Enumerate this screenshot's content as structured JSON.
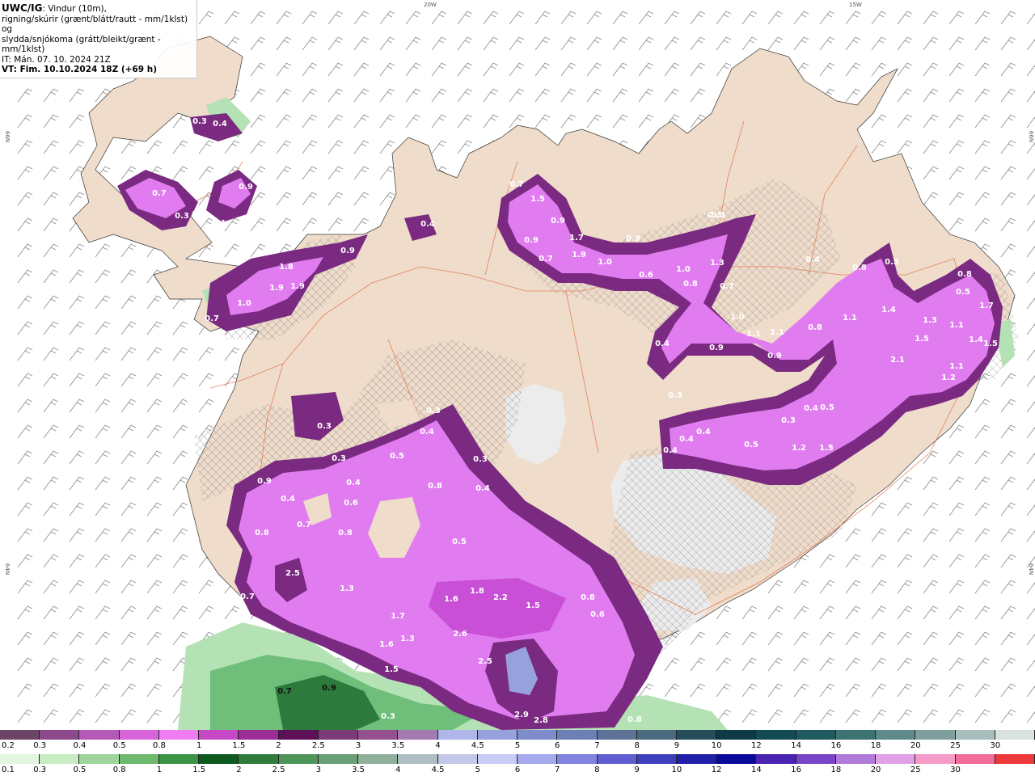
{
  "title": {
    "model": "UWC/IG",
    "line1_rest": ": Vindur (10m),",
    "line2": "rigning/skúrir (grænt/blátt/rautt - mm/1klst) og",
    "line3": "slydda/snjókoma (grátt/bleikt/grænt - mm/1klst)",
    "line4": "IT: Mán. 07. 10. 2024 21Z",
    "line5": "VT: Fim. 10.10.2024 18Z (+69 h)"
  },
  "grid_labels": {
    "top_20w": "20W",
    "top_15w": "15W",
    "left_66n": "66N",
    "right_66n": "66N",
    "left_64n": "64N",
    "right_64n": "64N"
  },
  "colors": {
    "land": "#efdccb",
    "glacier": "#ececec",
    "road": "#e2724a",
    "snow_light": "#e07cf0",
    "snow_mid": "#c84fd6",
    "snow_dark": "#7a2a80",
    "rain_light": "#b5e2b5",
    "rain_mid": "#6fbf7a",
    "rain_dark": "#2e7a3c",
    "barb": "#8a8a8a"
  },
  "value_labels": [
    {
      "t": "0.3"
    },
    {
      "t": "0.4"
    },
    {
      "t": "0.7"
    },
    {
      "t": "0.9"
    },
    {
      "t": "0.3"
    },
    {
      "t": "0.4"
    },
    {
      "t": "0.4"
    },
    {
      "t": "1.8"
    },
    {
      "t": "1.9"
    },
    {
      "t": "1.9"
    },
    {
      "t": "1.0"
    },
    {
      "t": "0.7"
    },
    {
      "t": "0.9"
    },
    {
      "t": "0.7"
    },
    {
      "t": "1.5"
    },
    {
      "t": "0.9"
    },
    {
      "t": "0.9"
    },
    {
      "t": "1.7"
    },
    {
      "t": "1.9"
    },
    {
      "t": "1.0"
    },
    {
      "t": "0.7"
    },
    {
      "t": "0.9"
    },
    {
      "t": "0.6"
    },
    {
      "t": "1.0"
    },
    {
      "t": "0.8"
    },
    {
      "t": "1.3"
    },
    {
      "t": "0.7"
    },
    {
      "t": "0.3"
    },
    {
      "t": "0.5"
    },
    {
      "t": "0.8"
    },
    {
      "t": "0.4"
    },
    {
      "t": "1.0"
    },
    {
      "t": "1.1"
    },
    {
      "t": "1.1"
    },
    {
      "t": "0.8"
    },
    {
      "t": "1.4"
    },
    {
      "t": "1.1"
    },
    {
      "t": "1.3"
    },
    {
      "t": "1.5"
    },
    {
      "t": "1.1"
    },
    {
      "t": "1.7"
    },
    {
      "t": "0.8"
    },
    {
      "t": "0.5"
    },
    {
      "t": "0.9"
    },
    {
      "t": "0.9"
    },
    {
      "t": "2.1"
    },
    {
      "t": "1.2"
    },
    {
      "t": "1.1"
    },
    {
      "t": "1.4"
    },
    {
      "t": "1.5"
    },
    {
      "t": "0.4"
    },
    {
      "t": "0.3"
    },
    {
      "t": "0.4"
    },
    {
      "t": "0.4"
    },
    {
      "t": "0.4"
    },
    {
      "t": "0.3"
    },
    {
      "t": "0.5"
    },
    {
      "t": "0.4"
    },
    {
      "t": "0.5"
    },
    {
      "t": "1.2"
    },
    {
      "t": "1.5"
    },
    {
      "t": "0.4"
    },
    {
      "t": "0.3"
    },
    {
      "t": "0.3"
    },
    {
      "t": "0.3"
    },
    {
      "t": "0.4"
    },
    {
      "t": "0.3"
    },
    {
      "t": "0.5"
    },
    {
      "t": "0.9"
    },
    {
      "t": "0.4"
    },
    {
      "t": "0.4"
    },
    {
      "t": "0.8"
    },
    {
      "t": "0.4"
    },
    {
      "t": "0.3"
    },
    {
      "t": "0.6"
    },
    {
      "t": "0.7"
    },
    {
      "t": "0.8"
    },
    {
      "t": "0.8"
    },
    {
      "t": "0.5"
    },
    {
      "t": "2.5"
    },
    {
      "t": "0.7"
    },
    {
      "t": "1.3"
    },
    {
      "t": "1.6"
    },
    {
      "t": "1.8"
    },
    {
      "t": "2.2"
    },
    {
      "t": "1.5"
    },
    {
      "t": "0.8"
    },
    {
      "t": "0.6"
    },
    {
      "t": "1.7"
    },
    {
      "t": "2.6"
    },
    {
      "t": "1.6"
    },
    {
      "t": "1.3"
    },
    {
      "t": "2.5"
    },
    {
      "t": "1.5"
    },
    {
      "t": "0.7"
    },
    {
      "t": "0.9"
    },
    {
      "t": "2.9"
    },
    {
      "t": "2.8"
    },
    {
      "t": "0.8"
    },
    {
      "t": "0.3"
    }
  ],
  "legend": {
    "snow_colors": [
      "#6b4466",
      "#8c4a8c",
      "#b45ab6",
      "#d765d9",
      "#f07cf2",
      "#c548c4",
      "#9a2d96",
      "#5d0f58",
      "#7c3a78",
      "#94508f",
      "#a47ab2",
      "#b1b6ea",
      "#96a1de",
      "#7f8ccb",
      "#6c80b5",
      "#5d7296",
      "#4b6a7f",
      "#264d5a",
      "#0e3a45",
      "#124b52",
      "#1f5a5f",
      "#3e7373",
      "#5e8b8a",
      "#7e9f9c",
      "#a7bdbb",
      "#d9e2df"
    ],
    "snow_labels": [
      "0.2",
      "0.3",
      "0.4",
      "0.5",
      "0.8",
      "1",
      "1.5",
      "2",
      "2.5",
      "3",
      "3.5",
      "4",
      "4.5",
      "5",
      "6",
      "7",
      "8",
      "9",
      "10",
      "12",
      "14",
      "16",
      "18",
      "20",
      "25",
      "30"
    ],
    "rain_colors": [
      "#e3f6df",
      "#c8ecc2",
      "#9fd59b",
      "#6db86c",
      "#3c9546",
      "#0f5a1e",
      "#2f7c3d",
      "#4e9559",
      "#6a9f77",
      "#8fb09a",
      "#aebfc4",
      "#c3c8e8",
      "#c9ccf6",
      "#a5a9ee",
      "#8083e0",
      "#5e5ed0",
      "#3f3fbe",
      "#2020a8",
      "#0a0a9a",
      "#4a24b0",
      "#7a44c8",
      "#b07ad8",
      "#e0a2e4",
      "#f59bc8",
      "#f26c98",
      "#ee3a3a"
    ],
    "rain_labels": [
      "0.1",
      "0.3",
      "0.5",
      "0.8",
      "1",
      "1.5",
      "2",
      "2.5",
      "3",
      "3.5",
      "4",
      "4.5",
      "5",
      "6",
      "7",
      "8",
      "9",
      "10",
      "12",
      "14",
      "16",
      "18",
      "20",
      "25",
      "30"
    ]
  }
}
